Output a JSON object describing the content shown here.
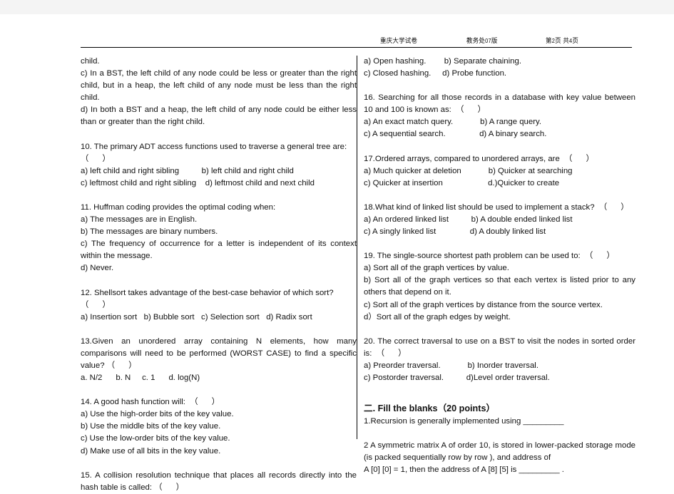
{
  "header": {
    "university": "重庆大学试卷",
    "department": "教务处",
    "department_edition": "07",
    "department_suffix": "版",
    "page_prefix": "第",
    "page_number": "2",
    "page_mid": "页 共",
    "page_total": "4",
    "page_suffix": "页"
  },
  "left_column": {
    "q9_cont": {
      "line1": "child.",
      "line2": "c) In a BST, the left child of any node could be less or greater than the right child, but in a heap, the left child of any node must be less than the right child.",
      "line3": "d) In both a BST and a heap, the left child of any node could be either less than or greater than the right child."
    },
    "q10": {
      "stem": "10. The primary ADT access functions used to traverse a general tree are:\n（      ）",
      "choices": "a) left child and right sibling          b) left child and right child\nc) leftmost child and right sibling    d) leftmost child and next child"
    },
    "q11": {
      "stem": "11. Huffman coding provides the optimal coding when:",
      "a": "a) The messages are in English.",
      "b": "b) The messages are binary numbers.",
      "c": "c) The frequency of occurrence for a letter is independent of its context within the message.",
      "d": "d) Never."
    },
    "q12": {
      "stem": "12. Shellsort takes advantage of the best-case behavior of which sort?\n（      ）",
      "choices": "a) Insertion sort   b) Bubble sort   c) Selection sort   d) Radix sort"
    },
    "q13": {
      "stem": "13.Given an unordered array containing N elements, how many comparisons will need to be performed (WORST CASE) to find a specific value? （      ）",
      "choices": "a. N/2      b. N     c. 1      d. log(N)"
    },
    "q14": {
      "stem": "14. A good hash function will:  （      ）",
      "a": "a) Use the high-order bits of the key value.",
      "b": "b) Use the middle bits of the key value.",
      "c": "c) Use the low-order bits of the key value.",
      "d": "d) Make use of all bits in the key value."
    },
    "q15": {
      "stem": "15. A collision resolution technique that places all records directly into the hash table is called: （      ）"
    }
  },
  "right_column": {
    "q15_choices": {
      "row1": "a) Open hashing.        b) Separate chaining.",
      "row2": "c) Closed hashing.     d) Probe function."
    },
    "q16": {
      "stem": "16. Searching for all those records in a database with key value between 10 and 100 is known as:  （      ）",
      "choices": "a) An exact match query.            b) A range query.\nc) A sequential search.               d) A binary search."
    },
    "q17": {
      "stem": "17.Ordered arrays, compared to unordered arrays, are  （      ）",
      "choices": "a) Much quicker at deletion            b) Quicker at searching\nc) Quicker at insertion                    d.)Quicker to create"
    },
    "q18": {
      "stem": "18.What kind of linked list should be used to implement a stack?  （      ）",
      "choices": "a) An ordered linked list          b) A double ended linked list\nc) A singly linked list               d) A doubly linked list"
    },
    "q19": {
      "stem": "19. The single-source shortest path problem can be used to:  （      ）",
      "a": "a) Sort all of the graph vertices by value.",
      "b": "b) Sort all of the graph vertices so that each vertex is listed prior to any others that depend on it.",
      "c": "c) Sort all of the graph vertices by distance from the source vertex.",
      "d": "d）Sort all of the graph edges by weight."
    },
    "q20": {
      "stem": "20. The correct traversal to use on a BST to visit the nodes in sorted order is:  （      ）",
      "choices": "a) Preorder traversal.            b) Inorder traversal.\nc) Postorder traversal.          d)Level order traversal."
    },
    "section2": {
      "title": "二. Fill the blanks（20 points）",
      "item1": "1.Recursion is generally implemented using _________",
      "item2": "2 A symmetric matrix A of order 10, is stored in lower-packed storage mode (is packed sequentially row by row ), and address of",
      "item2_line3": "A [0] [0] = 1, then the address of A [8] [5] is _________ ."
    }
  }
}
